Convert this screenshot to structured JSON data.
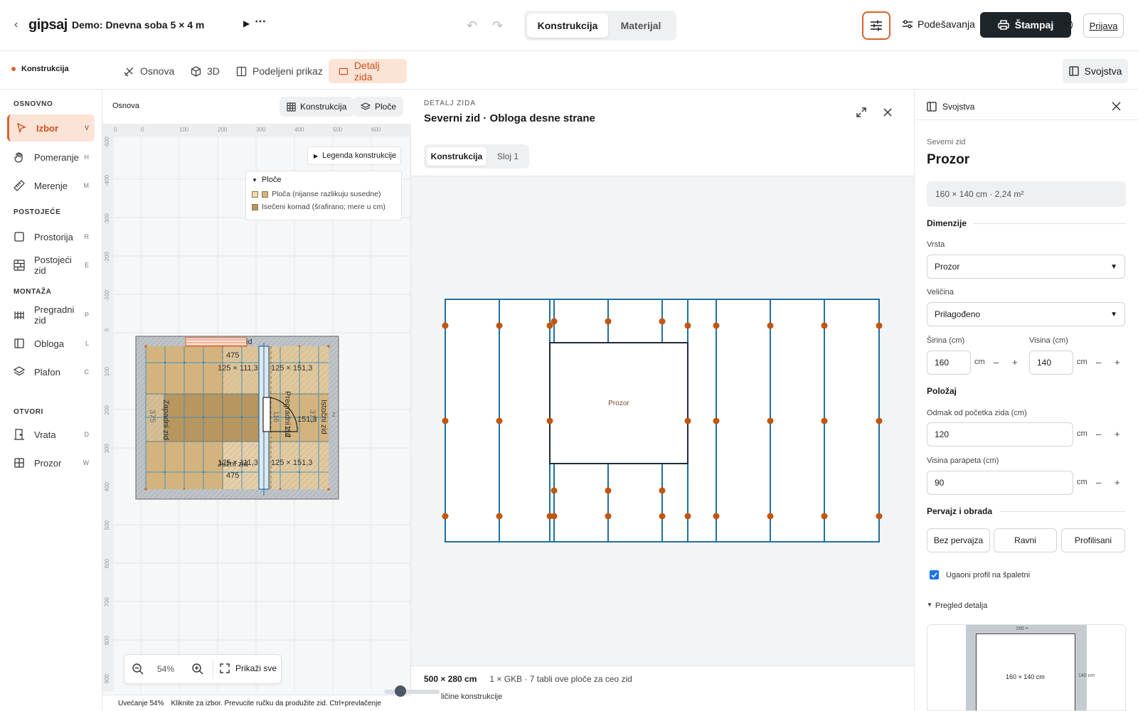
{
  "app": {
    "logo": "gipsaj",
    "project_title": "Demo: Dnevna soba 5 × 4 m",
    "play_icon": "▶",
    "more_icon": "⋯"
  },
  "mode_toggle": {
    "active": "Konstrukcija",
    "inactive": "Materijal"
  },
  "header_actions": {
    "settings": "Podešavanja",
    "print": "Štampaj",
    "login": "Prijava",
    "help": "?"
  },
  "section": {
    "title": "Konstrukcija",
    "accent": "#d9622b"
  },
  "view_tabs": [
    {
      "label": "Osnova",
      "icon": "pencil-ruler-icon"
    },
    {
      "label": "3D",
      "icon": "cube-icon"
    },
    {
      "label": "Podeljeni prikaz",
      "icon": "split-view-icon"
    },
    {
      "label": "Detalj zida",
      "icon": "wall-detail-icon",
      "active": true
    }
  ],
  "properties_toggle": "Svojstva",
  "sidebar": {
    "sections": [
      "OSNOVNO",
      "POSTOJEĆE",
      "MONTAŽA",
      "OTVORI"
    ],
    "items": [
      {
        "label": "Izbor",
        "key": "V",
        "active": true
      },
      {
        "label": "Pomeranje",
        "key": "H"
      },
      {
        "label": "Merenje",
        "key": "M"
      },
      {
        "label": "Prostorija",
        "key": "R"
      },
      {
        "label": "Postojeći zid",
        "key": "E"
      },
      {
        "label": "Pregradni zid",
        "key": "P"
      },
      {
        "label": "Obloga",
        "key": "L"
      },
      {
        "label": "Plafon",
        "key": "C"
      },
      {
        "label": "Vrata",
        "key": "D"
      },
      {
        "label": "Prozor",
        "key": "W"
      }
    ]
  },
  "plan": {
    "title": "Osnova",
    "chips": [
      "Konstrukcija",
      "Ploče"
    ],
    "ruler_top": [
      "0",
      "0",
      "100",
      "200",
      "300",
      "400",
      "500",
      "600"
    ],
    "ruler_left": [
      "-500",
      "-400",
      "-300",
      "-200",
      "-100",
      "0",
      "100",
      "200",
      "300",
      "400",
      "500",
      "600",
      "700",
      "800",
      "900"
    ],
    "legend_collapsed": "Legenda konstrukcije",
    "legend_open_title": "Ploče",
    "legend_entries": [
      "Ploča (nijanse razlikuju susedne)",
      "Isečeni komad (šrafirano; mere u cm)"
    ],
    "labels": {
      "north_end": "id",
      "top_dim": "475",
      "bottom_dim": "475",
      "west": "Zapadni zid",
      "east": "Istočni zid",
      "south": "Južni zid",
      "partition": "Pregradni zid",
      "partition_num": "112",
      "cut_a": "125 × 111,3",
      "cut_b": "125 × 151,3",
      "cut_c": "125 × 111,3",
      "cut_d": "125 × 151,3",
      "left_dim": "375",
      "right_dim": "375",
      "mid_dim": "151,3",
      "small_a": "116",
      "small_b": "2"
    },
    "zoom": "54%",
    "fit": "Prikaži sve",
    "status_zoom": "Uvećanje 54%",
    "status_hint": "Kliknite za izbor. Prevucite ručku da produžite zid. Ctrl+prevlačenje"
  },
  "detail": {
    "kicker": "DETALJ ZIDA",
    "title": "Severni zid · Obloga desne strane",
    "tabs": [
      "Konstrukcija",
      "Sloj 1"
    ],
    "opening_label": "Prozor",
    "footer_size": "500 × 280 cm",
    "footer_info": "1 × GKB · 7 tabli ove ploče za ceo zid",
    "slider_label": "ličine konstrukcije",
    "stud_color": "#1f6fa0",
    "screw_color": "#c2560f"
  },
  "properties": {
    "header": "Svojstva",
    "wall": "Severni zid",
    "element": "Prozor",
    "summary": "160 × 140 cm · 2,24 m²",
    "dimensions_title": "Dimenzije",
    "type_label": "Vrsta",
    "type_value": "Prozor",
    "size_label": "Veličina",
    "size_value": "Prilagođeno",
    "width_label": "Širina (cm)",
    "width_value": "160",
    "height_label": "Visina (cm)",
    "height_value": "140",
    "unit": "cm",
    "position_title": "Položaj",
    "offset_label": "Odmak od početka zida (cm)",
    "offset_value": "120",
    "sill_label": "Visina parapeta (cm)",
    "sill_value": "90",
    "trim_title": "Pervajz i obrada",
    "trim_options": [
      "Bez pervajza",
      "Ravni",
      "Profilisani"
    ],
    "corner_profile": "Ugaoni profil na špaletni",
    "preview_title": "Pregled detalja",
    "preview_dim_w": "160 ×",
    "preview_inner": "160 × 140 cm",
    "preview_dim_h": "140 cm"
  }
}
